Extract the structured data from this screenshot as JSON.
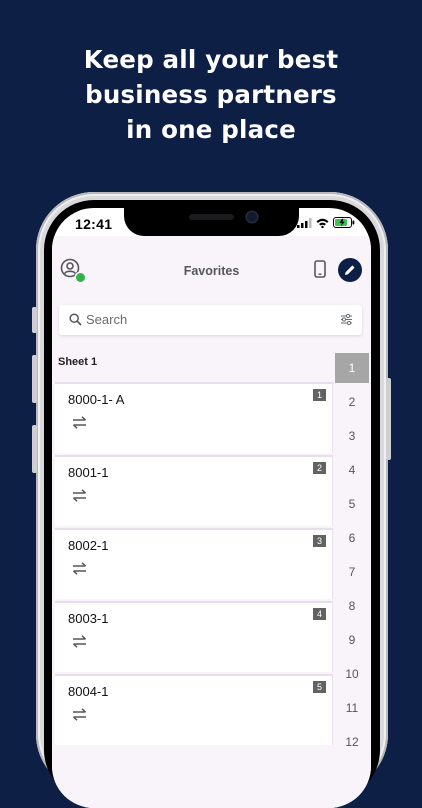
{
  "headline": {
    "line1": "Keep all your best",
    "line2": "business partners",
    "line3": "in one place"
  },
  "status_bar": {
    "time": "12:41"
  },
  "header": {
    "title": "Favorites"
  },
  "search": {
    "placeholder": "Search"
  },
  "sheet": {
    "label": "Sheet 1"
  },
  "cards": [
    {
      "title": "8000-1- A",
      "badge": "1"
    },
    {
      "title": "8001-1",
      "badge": "2"
    },
    {
      "title": "8002-1",
      "badge": "3"
    },
    {
      "title": "8003-1",
      "badge": "4"
    },
    {
      "title": "8004-1",
      "badge": "5"
    }
  ],
  "index": [
    "1",
    "2",
    "3",
    "4",
    "5",
    "6",
    "7",
    "8",
    "9",
    "10",
    "11",
    "12"
  ],
  "colors": {
    "background": "#0d1f45",
    "accent": "#0d1f45",
    "online": "#2fb34a",
    "active_index": "#a6a6a6",
    "battery": "#3ec44f"
  }
}
